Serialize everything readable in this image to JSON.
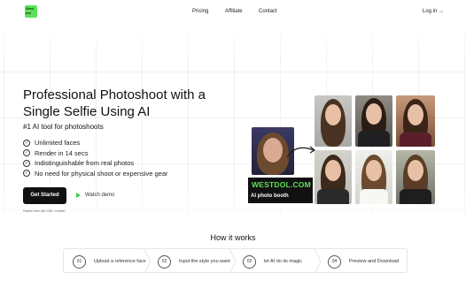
{
  "nav": {
    "logo_text": "West dol",
    "links": [
      "Pricing",
      "Affiliate",
      "Contact"
    ],
    "login": "Log in →"
  },
  "hero": {
    "title": "Professional Photoshoot with a Single Selfie Using AI",
    "subtitle": "#1 AI tool for photoshoots",
    "features": [
      "Unlimited faces",
      "Render in 14 secs",
      "Indistinguishable from real photos",
      "No need for physical shoot or expensive gear"
    ],
    "cta": "Get Started",
    "watch_demo": "Watch demo",
    "price_note": "Starts from $0.028 / render"
  },
  "showcase": {
    "badge_name": "WESTDOL.COM",
    "badge_sub": "AI photo booth"
  },
  "how": {
    "title": "How it works",
    "steps": [
      {
        "num": "01",
        "text": "Upload a reference face"
      },
      {
        "num": "02",
        "text": "Input the style you want"
      },
      {
        "num": "03",
        "text": "let AI do its magic"
      },
      {
        "num": "04",
        "text": "Preview and Download"
      }
    ]
  },
  "colors": {
    "accent_green": "#5ee25a",
    "cta_bg": "#111111"
  }
}
